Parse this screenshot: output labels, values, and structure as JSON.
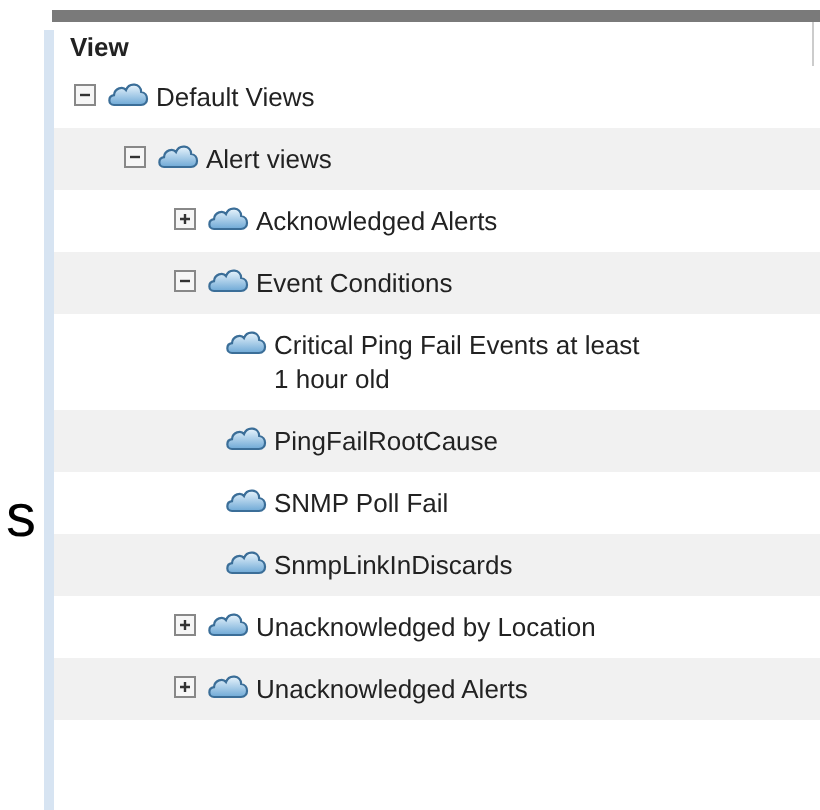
{
  "side_text": "s",
  "panel": {
    "column": "View",
    "tree": [
      {
        "label": "Default Views",
        "expanded": true,
        "children": [
          {
            "label": "Alert views",
            "expanded": true,
            "children": [
              {
                "label": "Acknowledged Alerts",
                "expanded": false
              },
              {
                "label": "Event Conditions",
                "expanded": true,
                "children": [
                  {
                    "label": "Critical Ping Fail Events at least 1 hour old"
                  },
                  {
                    "label": "PingFailRootCause"
                  },
                  {
                    "label": "SNMP Poll Fail"
                  },
                  {
                    "label": "SnmpLinkInDiscards"
                  }
                ]
              },
              {
                "label": "Unacknowledged by Location",
                "expanded": false
              },
              {
                "label": "Unacknowledged Alerts",
                "expanded": false
              }
            ]
          }
        ]
      }
    ]
  }
}
